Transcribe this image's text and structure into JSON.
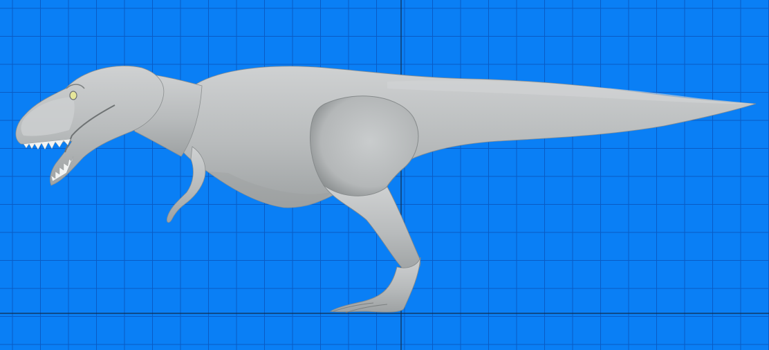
{
  "viewport": {
    "view": "side",
    "background_color": "#0a7ff5",
    "grid_minor_color": "#0a5bc4",
    "grid_major_color": "#102a4a",
    "model_base_color": "#b9bcbd",
    "model_shadow_color": "#8f9394",
    "model_highlight_color": "#d4d6d7",
    "eye_color": "#e6e69a",
    "teeth_color": "#f2f4f4"
  },
  "model": {
    "name_icon": "tyrannosaurus-model-icon"
  }
}
